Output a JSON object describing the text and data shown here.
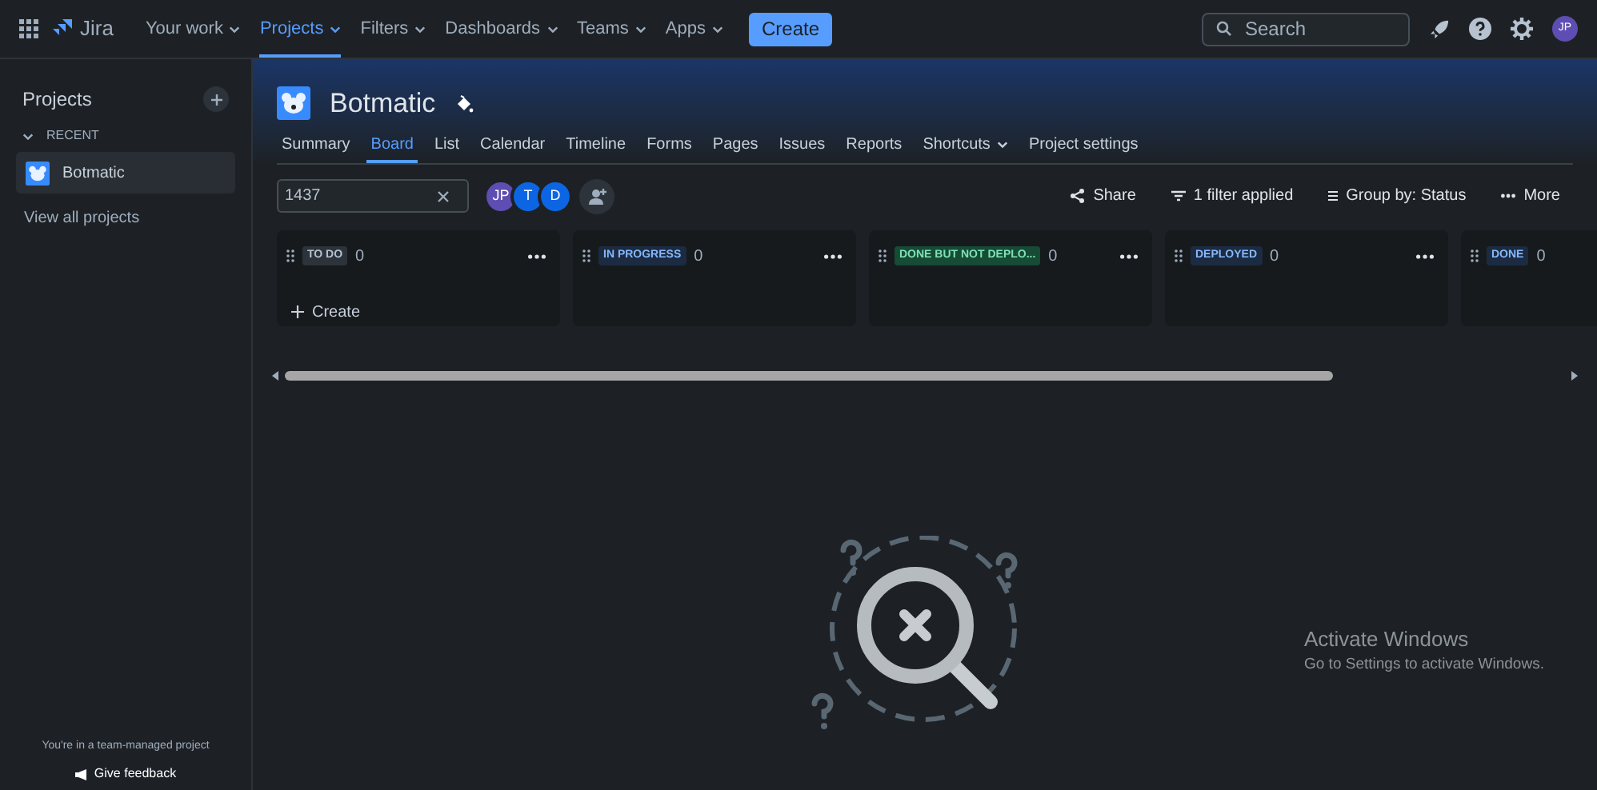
{
  "top_nav": {
    "product": "Jira",
    "items": [
      {
        "label": "Your work",
        "selected": false
      },
      {
        "label": "Projects",
        "selected": true
      },
      {
        "label": "Filters",
        "selected": false
      },
      {
        "label": "Dashboards",
        "selected": false
      },
      {
        "label": "Teams",
        "selected": false
      },
      {
        "label": "Apps",
        "selected": false
      }
    ],
    "create_button": "Create",
    "search": {
      "placeholder": "Search"
    },
    "avatar": "JP"
  },
  "sidebar": {
    "title": "Projects",
    "section": "RECENT",
    "items": [
      {
        "label": "Botmatic",
        "selected": true
      }
    ],
    "view_all": "View all projects",
    "footer_note": "You're in a team-managed project",
    "feedback": "Give feedback"
  },
  "project": {
    "name": "Botmatic",
    "tabs": [
      {
        "label": "Summary",
        "selected": false,
        "dropdown": false
      },
      {
        "label": "Board",
        "selected": true,
        "dropdown": false
      },
      {
        "label": "List",
        "selected": false,
        "dropdown": false
      },
      {
        "label": "Calendar",
        "selected": false,
        "dropdown": false
      },
      {
        "label": "Timeline",
        "selected": false,
        "dropdown": false
      },
      {
        "label": "Forms",
        "selected": false,
        "dropdown": false
      },
      {
        "label": "Pages",
        "selected": false,
        "dropdown": false
      },
      {
        "label": "Issues",
        "selected": false,
        "dropdown": false
      },
      {
        "label": "Reports",
        "selected": false,
        "dropdown": false
      },
      {
        "label": "Shortcuts",
        "selected": false,
        "dropdown": true
      },
      {
        "label": "Project settings",
        "selected": false,
        "dropdown": false
      }
    ]
  },
  "toolbar": {
    "search_value": "1437",
    "avatars": [
      {
        "initials": "JP",
        "color": "#5e4db2"
      },
      {
        "initials": "T",
        "color": "#0c66e4"
      },
      {
        "initials": "D",
        "color": "#0c66e4"
      }
    ],
    "actions": [
      "Share",
      "1 filter applied",
      "Group by: Status",
      "More"
    ]
  },
  "columns": [
    {
      "status": "TO DO",
      "count": "0",
      "color": "#2c333a",
      "create": "Create"
    },
    {
      "status": "IN PROGRESS",
      "count": "0",
      "color": "#1c2b41"
    },
    {
      "status": "DONE BUT NOT DEPLO...",
      "count": "0",
      "color": "#164b35"
    },
    {
      "status": "DEPLOYED",
      "count": "0",
      "color": "#1c2b41"
    },
    {
      "status": "DONE",
      "count": "0",
      "color": "#1c2b41"
    }
  ],
  "os_notice": {
    "title": "Activate Windows",
    "text": "Go to Settings to activate Windows."
  }
}
